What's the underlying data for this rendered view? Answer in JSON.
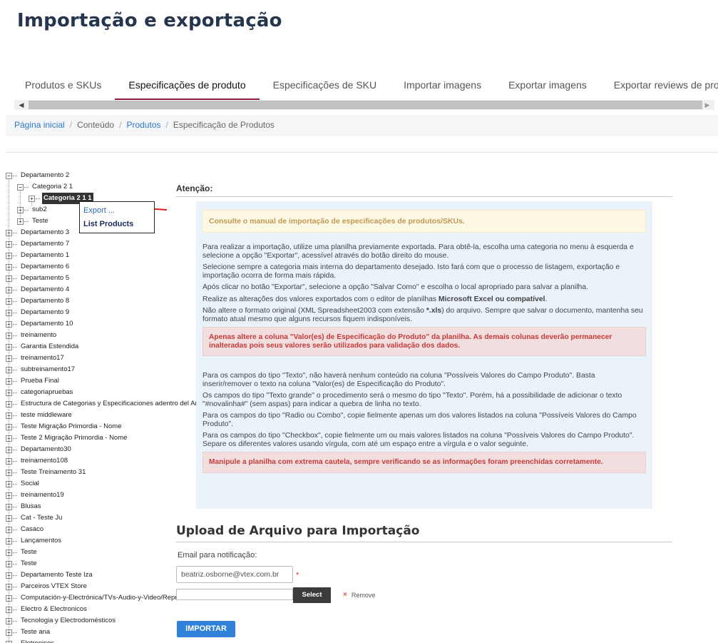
{
  "page": {
    "title": "Importação e exportação"
  },
  "tabs": [
    {
      "label": "Produtos e SKUs"
    },
    {
      "label": "Especificações de produto",
      "active": true
    },
    {
      "label": "Especificações de SKU"
    },
    {
      "label": "Importar imagens"
    },
    {
      "label": "Exportar imagens"
    },
    {
      "label": "Exportar reviews de produto"
    }
  ],
  "breadcrumb": {
    "items": [
      "Página inicial",
      "Conteúdo",
      "Produtos",
      "Especificação de Produtos"
    ],
    "separator": "/"
  },
  "tree": {
    "expand_glyph": "+",
    "collapse_glyph": "−",
    "nodes": [
      {
        "label": "Departamento 2",
        "level": 0,
        "toggle": "minus"
      },
      {
        "label": "Categoria 2 1",
        "level": 1,
        "toggle": "minus"
      },
      {
        "label": "Categoria 2 1 1",
        "level": 2,
        "toggle": "plus",
        "selected": true
      },
      {
        "label": "sub2",
        "level": 1,
        "toggle": "plus"
      },
      {
        "label": "Teste",
        "level": 1,
        "toggle": "plus"
      },
      {
        "label": "Departamento 3",
        "level": 0,
        "toggle": "plus"
      },
      {
        "label": "Departamento 7",
        "level": 0,
        "toggle": "plus"
      },
      {
        "label": "Departamento 1",
        "level": 0,
        "toggle": "plus"
      },
      {
        "label": "Departamento 6",
        "level": 0,
        "toggle": "plus"
      },
      {
        "label": "Departamento 5",
        "level": 0,
        "toggle": "plus"
      },
      {
        "label": "Departamento 4",
        "level": 0,
        "toggle": "plus"
      },
      {
        "label": "Departamento 8",
        "level": 0,
        "toggle": "plus"
      },
      {
        "label": "Departamento 9",
        "level": 0,
        "toggle": "plus"
      },
      {
        "label": "Departamento 10",
        "level": 0,
        "toggle": "plus"
      },
      {
        "label": "treinamento",
        "level": 0,
        "toggle": "plus"
      },
      {
        "label": "Garantia Estendida",
        "level": 0,
        "toggle": "plus"
      },
      {
        "label": "treinamento17",
        "level": 0,
        "toggle": "plus"
      },
      {
        "label": "subtreinamento17",
        "level": 0,
        "toggle": "plus"
      },
      {
        "label": "Prueba Final",
        "level": 0,
        "toggle": "plus"
      },
      {
        "label": "categoriapruebas",
        "level": 0,
        "toggle": "plus"
      },
      {
        "label": "Estructura de Categorias y Especificaciones adentro del Ambiente",
        "level": 0,
        "toggle": "plus"
      },
      {
        "label": "teste middleware",
        "level": 0,
        "toggle": "plus"
      },
      {
        "label": "Teste Migração Primordia - Nome",
        "level": 0,
        "toggle": "plus"
      },
      {
        "label": "Teste 2 Migração Primordia - Nome",
        "level": 0,
        "toggle": "plus"
      },
      {
        "label": "Departamento30",
        "level": 0,
        "toggle": "plus"
      },
      {
        "label": "treinamento108",
        "level": 0,
        "toggle": "plus"
      },
      {
        "label": "Teste Treinamento 31",
        "level": 0,
        "toggle": "plus"
      },
      {
        "label": "Social",
        "level": 0,
        "toggle": "plus"
      },
      {
        "label": "treinamento19",
        "level": 0,
        "toggle": "plus"
      },
      {
        "label": "Blusas",
        "level": 0,
        "toggle": "plus"
      },
      {
        "label": "Cat - Teste Ju",
        "level": 0,
        "toggle": "plus"
      },
      {
        "label": "Casaco",
        "level": 0,
        "toggle": "plus"
      },
      {
        "label": "Lançamentos",
        "level": 0,
        "toggle": "plus"
      },
      {
        "label": "Teste",
        "level": 0,
        "toggle": "plus"
      },
      {
        "label": "Teste",
        "level": 0,
        "toggle": "plus"
      },
      {
        "label": "Departamento Teste Iza",
        "level": 0,
        "toggle": "plus"
      },
      {
        "label": "Parceiros VTEX Store",
        "level": 0,
        "toggle": "plus"
      },
      {
        "label": "Computación-y-Electrónica/TVs-Audio-y-Video/Reproductores",
        "level": 0,
        "toggle": "plus"
      },
      {
        "label": "Electro & Electronicos",
        "level": 0,
        "toggle": "plus"
      },
      {
        "label": "Tecnologia y Electrodomésticos",
        "level": 0,
        "toggle": "plus"
      },
      {
        "label": "Teste ana",
        "level": 0,
        "toggle": "plus"
      },
      {
        "label": "Eletronicos",
        "level": 0,
        "toggle": "plus"
      }
    ]
  },
  "context_menu": {
    "export_label": "Export ...",
    "list_label": "List Products"
  },
  "attention": {
    "title": "Atenção:",
    "manual_notice": "Consulte o manual de importação de especificações de produtos/SKUs.",
    "paragraphs_1": [
      "Para realizar a importação, utilize uma planilha previamente exportada. Para obtê-la, escolha uma categoria no menu à esquerda e selecione a opção \"Exportar\", acessível através do botão direito do mouse.",
      "Selecione sempre a categoria mais interna do departamento desejado. Isto fará com que o processo de listagem, exportação e importação ocorra de forma mais rápida.",
      "Após clicar no botão \"Exportar\", selecione a opção \"Salvar Como\" e escolha o local apropriado para salvar a planilha."
    ],
    "editor_text": "Realize as alterações dos valores exportados com o editor de planilhas ",
    "editor_bold": "Microsoft Excel ou compatível",
    "editor_end": ".",
    "format_text_1": "Não altere o formato original (XML Spreadsheet2003 com extensão ",
    "format_bold": "*.xls",
    "format_text_2": ") do arquivo. Sempre que salvar o documento, mantenha seu formato atual mesmo que alguns recursos fiquem indisponíveis.",
    "warning_1": "Apenas altere a coluna \"Valor(es) de Especificação do Produto\" da planilha. As demais colunas deverão permanecer inalteradas pois seus valores serão utilizados para validação dos dados.",
    "paragraphs_2": [
      "Para os campos do tipo \"Texto\", não haverá nenhum conteúdo na coluna \"Possíveis Valores do Campo Produto\". Basta inserir/remover o texto na coluna \"Valor(es) de Especificação do Produto\".",
      "Os campos do tipo \"Texto grande\" o procedimento será o mesmo do tipo \"Texto\". Porém, há a possibilidade de adicionar o texto \"#novalinha#\" (sem aspas) para indicar a quebra de linha no texto.",
      "Para os campos do tipo \"Radio ou Combo\", copie fielmente apenas um dos valores listados na coluna \"Possíveis Valores do Campo Produto\".",
      "Para os campos do tipo \"Checkbox\", copie fielmente um ou mais valores listados na coluna \"Possíveis Valores do Campo Produto\". Separe os diferentes valores usando vírgula, com até um espaço entre a vírgula e o valor seguinte."
    ],
    "warning_2": "Manipule a planilha com extrema cautela, sempre verificando se as informações foram preenchidas corretamente."
  },
  "upload": {
    "title": "Upload de Arquivo para Importação",
    "email_label": "Email para notificação:",
    "email_value": "beatriz.osborne@vtex.com.br",
    "required_mark": "*",
    "select_label": "Select",
    "remove_icon": "×",
    "remove_label": "Remove",
    "import_label": "IMPORTAR"
  },
  "scrollbar": {
    "left_arrow": "◀",
    "right_arrow": "▶"
  },
  "colors": {
    "title": "#25354d",
    "tab_active_underline": "#8b1b3a",
    "link": "#2d78c8",
    "panel_bg": "#eaf2fa",
    "warning_text": "#c43b3b",
    "notice_text": "#c09853",
    "import_button": "#2f82d8",
    "select_button": "#3b3b3b",
    "annotation_arrow": "#e02020"
  }
}
